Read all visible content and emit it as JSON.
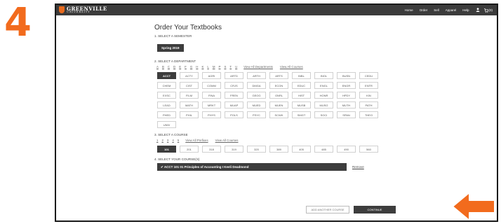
{
  "step_number": "4",
  "brand": {
    "name": "GREENVILLE",
    "sub": "UNIVERSITY"
  },
  "nav": {
    "items": [
      "Home",
      "Order",
      "Sell",
      "Apparel",
      "Help"
    ],
    "cart_count": "(0)"
  },
  "page_title": "Order Your Textbooks",
  "semester": {
    "heading": "1. SELECT A SEMESTER",
    "selected": "Spring 2019"
  },
  "department": {
    "heading": "2. SELECT A DEPARTMENT",
    "letters": [
      "A",
      "B",
      "C",
      "D",
      "E",
      "F",
      "G",
      "H",
      "K",
      "L",
      "M",
      "P",
      "S",
      "T",
      "U"
    ],
    "view_all_departments": "View All Departments",
    "view_all_courses": "View All Courses",
    "items": [
      "ACCT",
      "ACTY",
      "AGRI",
      "ARTD",
      "ARTH",
      "ARTS",
      "BIBL",
      "BIOL",
      "BUSN",
      "CEDU",
      "CHEM",
      "CIST",
      "COMM",
      "CRJS",
      "DMGA",
      "ECON",
      "EDUC",
      "ENGL",
      "ENGR",
      "ENTR",
      "EXSC",
      "FILM",
      "FINA",
      "FREN",
      "GEOG",
      "GNRL",
      "HIST",
      "HONR",
      "HPDY",
      "KIN",
      "LEAD",
      "MATH",
      "MRKT",
      "MUAP",
      "MUED",
      "MUEN",
      "MUSB",
      "MUSG",
      "MUTH",
      "PATH",
      "PHED",
      "PHIL",
      "PHYS",
      "POLS",
      "PSYC",
      "SCWK",
      "SMGT",
      "SOCI",
      "SPAN",
      "THEO",
      "UNIV"
    ],
    "selected": "ACCT"
  },
  "course": {
    "heading": "3. SELECT A COURSE",
    "prefixes": [
      "1",
      "2",
      "3",
      "4",
      "5"
    ],
    "view_all_prefixes": "View All Prefixes",
    "view_all_courses": "View All Courses",
    "items": [
      "101",
      "201",
      "318",
      "319",
      "320",
      "389",
      "405",
      "485",
      "490",
      "560"
    ],
    "selected": "101"
  },
  "selected_courses": {
    "heading": "4. SELECT YOUR COURSE(S)",
    "item": "✔ ACCT 101 01  Principles of Accounting I Keeli Deadmond",
    "remove": "Remove"
  },
  "actions": {
    "add_another": "ADD ANOTHER COURSE",
    "continue": "CONTINUE"
  },
  "colors": {
    "accent": "#f26b1d",
    "dark": "#3d3d3d",
    "topbar": "#3b3b3b"
  }
}
